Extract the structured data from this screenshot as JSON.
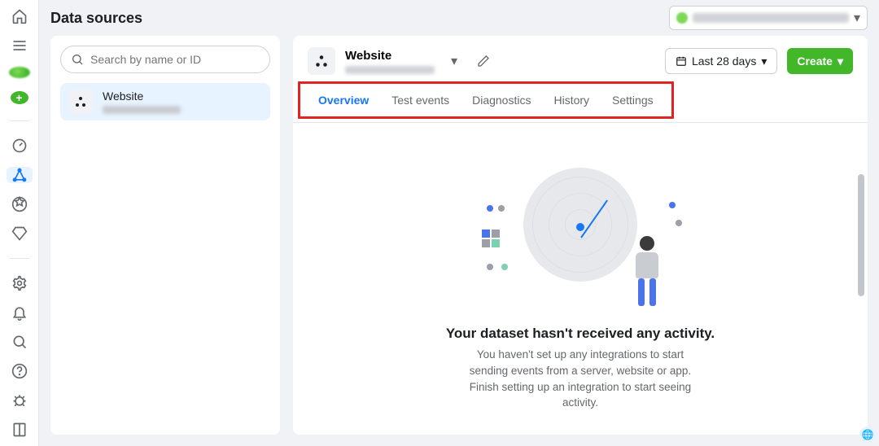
{
  "page": {
    "title": "Data sources"
  },
  "search": {
    "placeholder": "Search by name or ID"
  },
  "sidebar": {
    "items": [
      {
        "name": "Website"
      }
    ]
  },
  "content": {
    "source_title": "Website",
    "date_filter": "Last 28 days",
    "create_label": "Create",
    "tabs": [
      {
        "label": "Overview",
        "id": "overview"
      },
      {
        "label": "Test events",
        "id": "test-events"
      },
      {
        "label": "Diagnostics",
        "id": "diagnostics"
      },
      {
        "label": "History",
        "id": "history"
      },
      {
        "label": "Settings",
        "id": "settings"
      }
    ],
    "active_tab": "overview",
    "empty": {
      "heading": "Your dataset hasn't received any activity.",
      "body": "You haven't set up any integrations to start sending events from a server, website or app. Finish setting up an integration to start seeing activity."
    }
  },
  "rail": {
    "icons": [
      "home",
      "menu",
      "avatar",
      "add",
      "gauge",
      "share",
      "star-badge",
      "diamond",
      "settings",
      "bell",
      "search",
      "help",
      "bug",
      "book"
    ]
  }
}
